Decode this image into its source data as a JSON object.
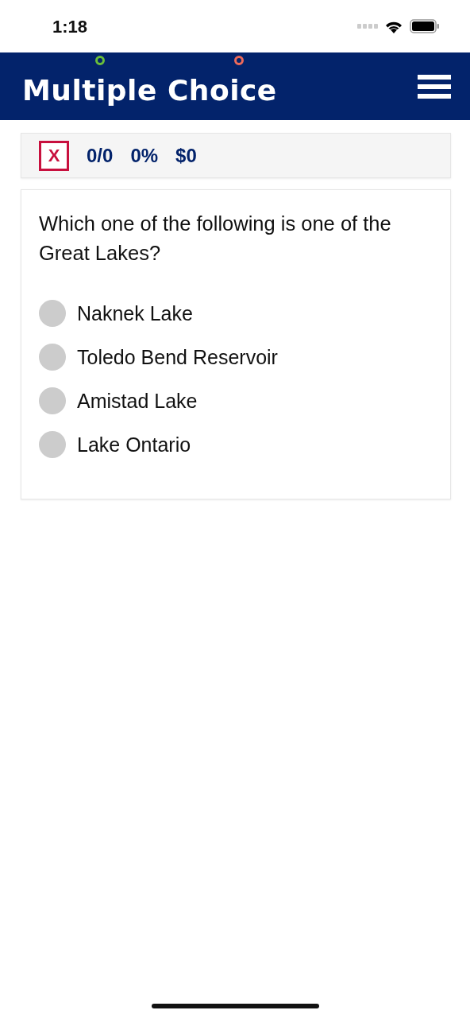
{
  "status_bar": {
    "time": "1:18"
  },
  "header": {
    "title": "Multiple Choice"
  },
  "score_bar": {
    "close_label": "X",
    "score": "0/0",
    "percent": "0%",
    "money": "$0"
  },
  "question": {
    "text": "Which one of the following is one of the Great Lakes?",
    "options": [
      {
        "label": "Naknek Lake",
        "selected": false
      },
      {
        "label": "Toledo Bend Reservoir",
        "selected": false
      },
      {
        "label": "Amistad Lake",
        "selected": false
      },
      {
        "label": "Lake Ontario",
        "selected": false
      }
    ]
  }
}
